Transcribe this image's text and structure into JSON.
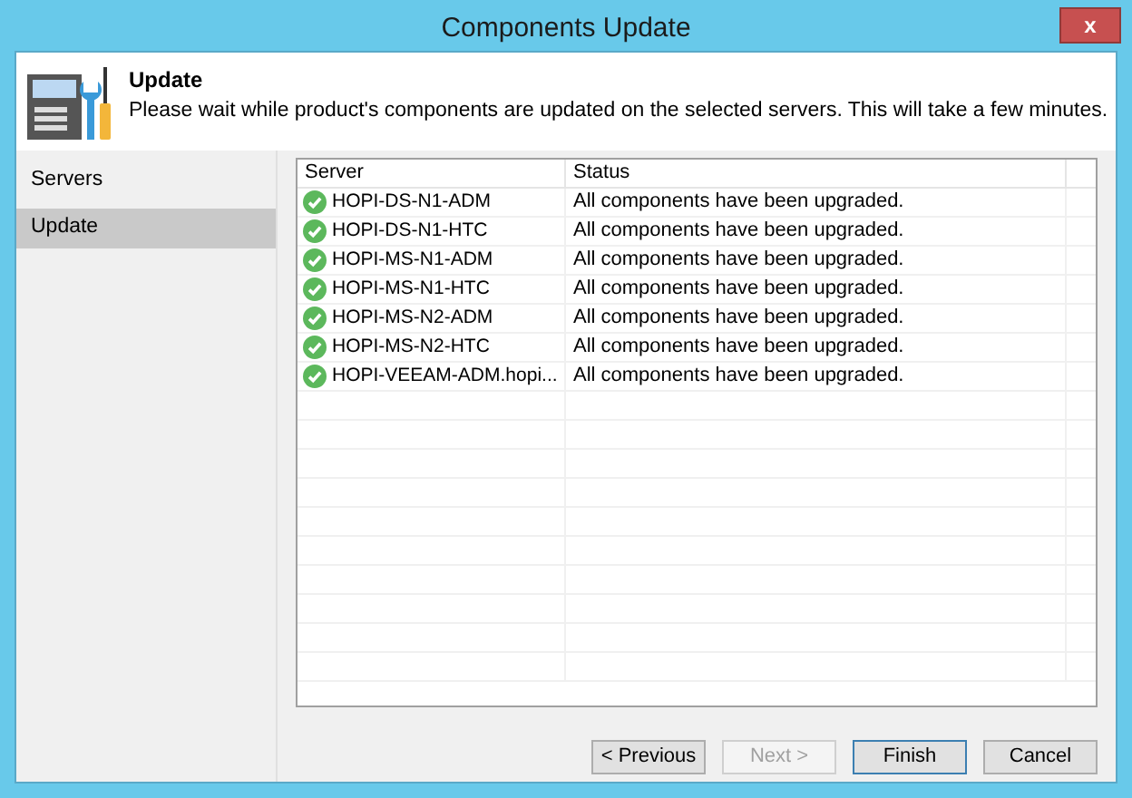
{
  "window": {
    "title": "Components Update",
    "close": "x"
  },
  "header": {
    "title": "Update",
    "description": "Please wait while product's components are updated on the selected servers. This will take a few minutes."
  },
  "sidebar": {
    "items": [
      {
        "label": "Servers",
        "selected": false
      },
      {
        "label": "Update",
        "selected": true
      }
    ]
  },
  "table": {
    "columns": [
      "Server",
      "Status"
    ],
    "rows": [
      {
        "server": "HOPI-DS-N1-ADM",
        "status": "All components have been upgraded.",
        "ok": true
      },
      {
        "server": "HOPI-DS-N1-HTC",
        "status": "All components have been upgraded.",
        "ok": true
      },
      {
        "server": "HOPI-MS-N1-ADM",
        "status": "All components have been upgraded.",
        "ok": true
      },
      {
        "server": "HOPI-MS-N1-HTC",
        "status": "All components have been upgraded.",
        "ok": true
      },
      {
        "server": "HOPI-MS-N2-ADM",
        "status": "All components have been upgraded.",
        "ok": true
      },
      {
        "server": "HOPI-MS-N2-HTC",
        "status": "All components have been upgraded.",
        "ok": true
      },
      {
        "server": "HOPI-VEEAM-ADM.hopi...",
        "status": "All components have been upgraded.",
        "ok": true
      }
    ]
  },
  "buttons": [
    {
      "label": "< Previous",
      "disabled": false,
      "default": false
    },
    {
      "label": "Next >",
      "disabled": true,
      "default": false
    },
    {
      "label": "Finish",
      "disabled": false,
      "default": true
    },
    {
      "label": "Cancel",
      "disabled": false,
      "default": false
    }
  ]
}
